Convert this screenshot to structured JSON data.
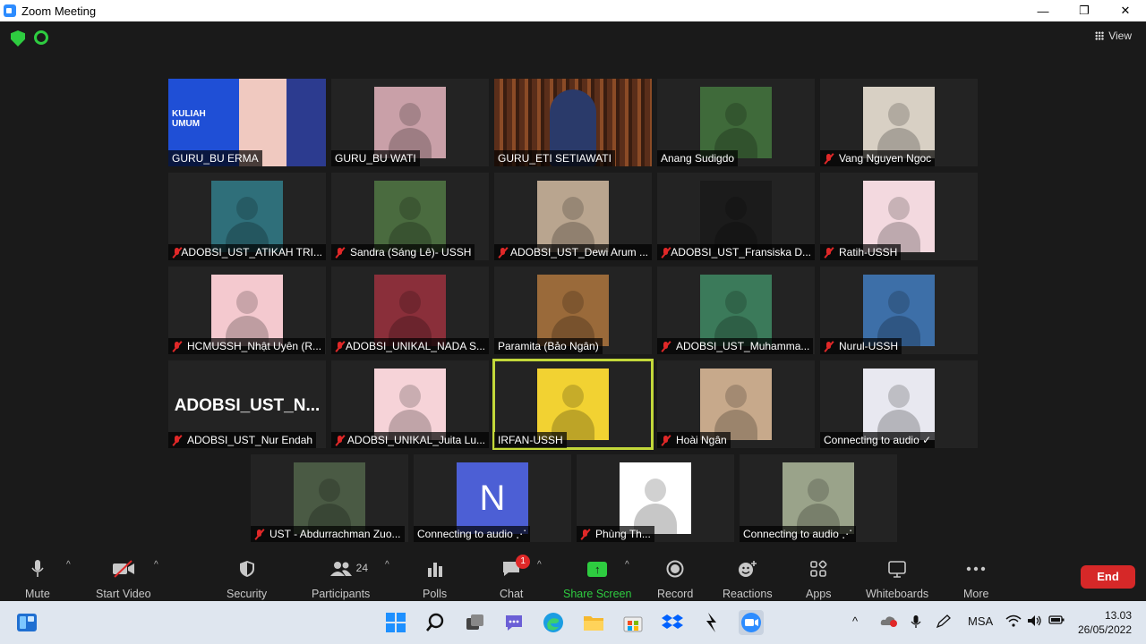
{
  "window": {
    "title": "Zoom Meeting",
    "minimize": "—",
    "restore": "❐",
    "close": "✕"
  },
  "top": {
    "view_label": "View"
  },
  "participants": [
    {
      "name": "GURU_BU ERMA",
      "muted": false,
      "kind": "banner",
      "banner_line1": "KULIAH",
      "banner_line2": "UMUM",
      "bg": "#1f4fd6"
    },
    {
      "name": "GURU_BU WATI",
      "muted": false,
      "kind": "photo",
      "bg": "#c9a0a8"
    },
    {
      "name": "GURU_ETI SETIAWATI",
      "muted": false,
      "kind": "wide",
      "bg": "#6b3b22"
    },
    {
      "name": "Anang Sudigdo",
      "muted": false,
      "kind": "photo",
      "bg": "#3f6a3a"
    },
    {
      "name": "Vang Nguyen Ngoc",
      "muted": true,
      "kind": "photo",
      "bg": "#d8d0c4"
    },
    {
      "name": "ADOBSI_UST_ATIKAH TRI...",
      "muted": true,
      "kind": "photo",
      "bg": "#2f6f7a"
    },
    {
      "name": "Sandra (Sáng Lê)- USSH",
      "muted": true,
      "kind": "photo",
      "bg": "#4a6b3f"
    },
    {
      "name": "ADOBSI_UST_Dewi Arum ...",
      "muted": true,
      "kind": "photo",
      "bg": "#b9a58f"
    },
    {
      "name": "ADOBSI_UST_Fransiska D...",
      "muted": true,
      "kind": "photo",
      "bg": "#1b1b1b"
    },
    {
      "name": "Ratih-USSH",
      "muted": true,
      "kind": "photo",
      "bg": "#f3d9df"
    },
    {
      "name": "HCMUSSH_Nhật Uyên (R...",
      "muted": true,
      "kind": "photo",
      "bg": "#f4c9cf"
    },
    {
      "name": "ADOBSI_UNIKAL_NADA S...",
      "muted": true,
      "kind": "photo",
      "bg": "#8a2f3a"
    },
    {
      "name": "Paramita (Bảo Ngân)",
      "muted": false,
      "kind": "photo",
      "bg": "#9a6a3a"
    },
    {
      "name": "ADOBSI_UST_Muhamma...",
      "muted": true,
      "kind": "photo",
      "bg": "#3b7a5a"
    },
    {
      "name": "Nurul-USSH",
      "muted": true,
      "kind": "photo",
      "bg": "#3d6fa8"
    },
    {
      "name": "ADOBSI_UST_Nur Endah",
      "muted": true,
      "kind": "text",
      "big": "ADOBSI_UST_N...",
      "bg": "#232323"
    },
    {
      "name": "ADOBSI_UNIKAL_Juita Lu...",
      "muted": true,
      "kind": "photo",
      "bg": "#f6d3d8"
    },
    {
      "name": "IRFAN-USSH",
      "muted": false,
      "kind": "photo",
      "bg": "#f2d232",
      "active": true
    },
    {
      "name": "Hoài Ngân",
      "muted": true,
      "kind": "photo",
      "bg": "#c7a98b"
    },
    {
      "name": "Connecting to audio ✓",
      "muted": false,
      "kind": "photo",
      "bg": "#e8e8f0"
    },
    {
      "name": "UST - Abdurrachman Zuo...",
      "muted": true,
      "kind": "photo",
      "bg": "#4a5a44"
    },
    {
      "name": "Connecting to audio ⋰",
      "muted": false,
      "kind": "letter",
      "letter": "N",
      "bg": "#4c5fd5"
    },
    {
      "name": "Phùng Th...",
      "muted": true,
      "kind": "photo",
      "bg": "#ffffff"
    },
    {
      "name": "Connecting to audio ⋰",
      "muted": false,
      "kind": "photo",
      "bg": "#9aa38a"
    }
  ],
  "toolbar": {
    "mute": "Mute",
    "start_video": "Start Video",
    "security": "Security",
    "participants": "Participants",
    "participant_count": "24",
    "polls": "Polls",
    "chat": "Chat",
    "chat_badge": "1",
    "share_screen": "Share Screen",
    "record": "Record",
    "reactions": "Reactions",
    "apps": "Apps",
    "whiteboards": "Whiteboards",
    "more": "More",
    "end": "End"
  },
  "taskbar": {
    "lang": "MSA",
    "time": "13.03",
    "date": "26/05/2022"
  },
  "colors": {
    "accent_green": "#2ecc40",
    "end_red": "#d62828",
    "active_speaker": "#c3d83a"
  }
}
